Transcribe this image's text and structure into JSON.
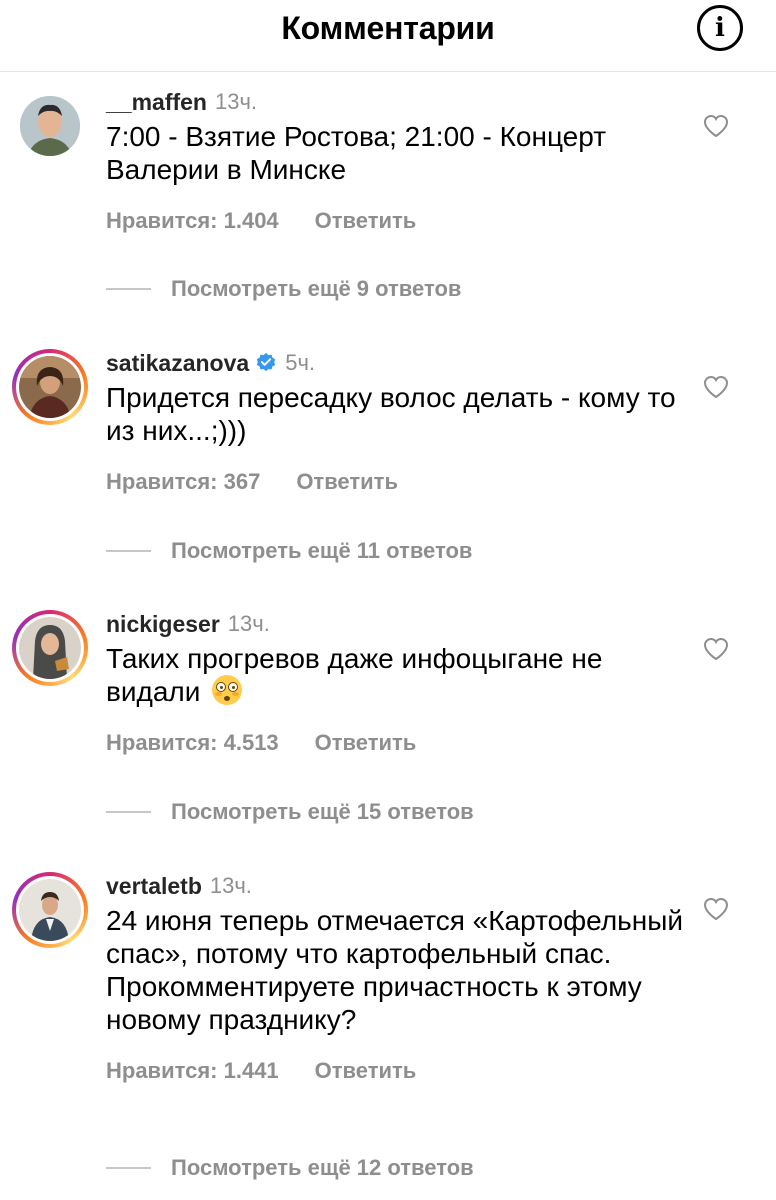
{
  "header": {
    "title": "Комментарии",
    "info_icon": "info-icon"
  },
  "comments": [
    {
      "username": "__maffen",
      "time": "13ч.",
      "text": "7:00 - Взятие Ростова; 21:00 - Концерт Валерии в Минске",
      "likes": "Нравится: 1.404",
      "reply": "Ответить",
      "view_replies": "Посмотреть ещё 9 ответов",
      "verified": false,
      "has_story_ring": false
    },
    {
      "username": "satikazanova",
      "time": "5ч.",
      "text": "Придется пересадку волос делать - кому то из них...;)))",
      "likes": "Нравится: 367",
      "reply": "Ответить",
      "view_replies": "Посмотреть ещё 11 ответов",
      "verified": true,
      "has_story_ring": true
    },
    {
      "username": "nickigeser",
      "time": "13ч.",
      "text": "Таких прогревов даже инфоцыгане не видали",
      "emoji": "flushed-face-emoji",
      "likes": "Нравится: 4.513",
      "reply": "Ответить",
      "view_replies": "Посмотреть ещё 15 ответов",
      "verified": false,
      "has_story_ring": true
    },
    {
      "username": "vertaletb",
      "time": "13ч.",
      "text": "24 июня теперь отмечается «Картофельный спас», потому что картофельный спас. Прокомментируете причастность к этому новому празднику?",
      "likes": "Нравится: 1.441",
      "reply": "Ответить",
      "view_replies": "Посмотреть ещё 12 ответов",
      "verified": false,
      "has_story_ring": true
    }
  ],
  "colors": {
    "secondary_text": "#8e8e8e",
    "verified_blue": "#3897f0",
    "divider": "#e4e4e4"
  }
}
